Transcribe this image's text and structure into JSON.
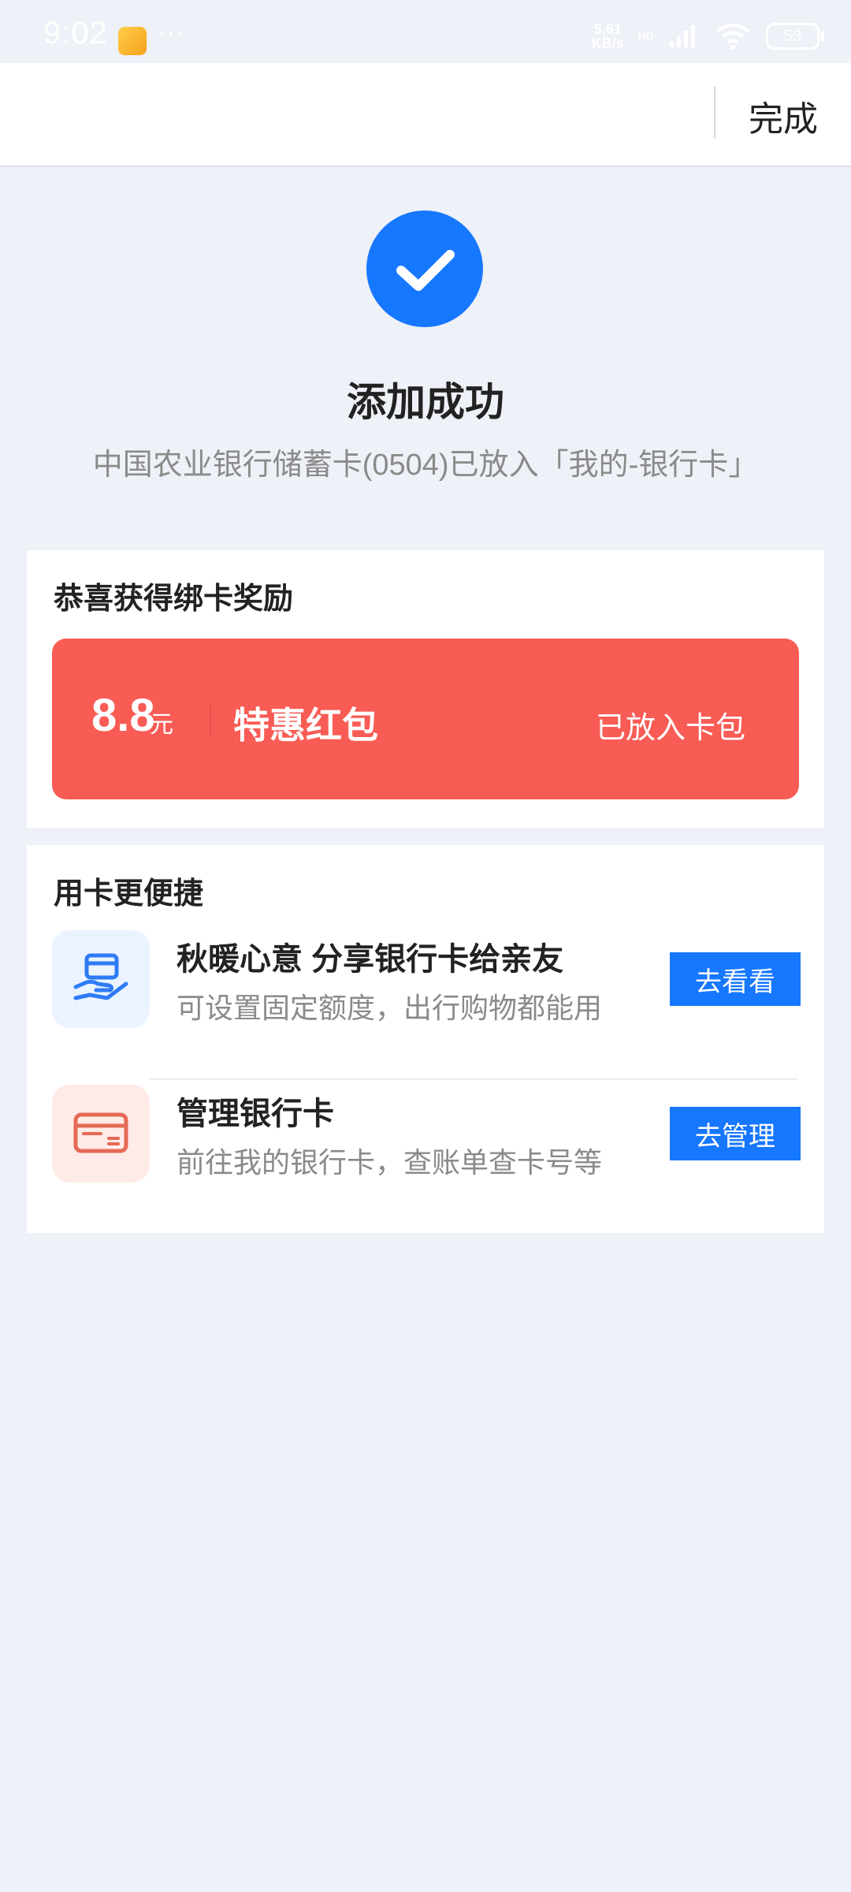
{
  "status_bar": {
    "time": "9:02",
    "dots": "···",
    "net_speed_value": "5.61",
    "net_speed_unit": "KB/s",
    "network_badge": "HD",
    "battery": "53"
  },
  "top_bar": {
    "done_label": "完成"
  },
  "success": {
    "icon": "checkmark-icon",
    "title": "添加成功",
    "subtitle": "中国农业银行储蓄卡(0504)已放入「我的-银行卡」"
  },
  "reward": {
    "section_title": "恭喜获得绑卡奖励",
    "amount": "8.8",
    "unit": "元",
    "name": "特惠红包",
    "status": "已放入卡包",
    "banner_color": "#f85c55"
  },
  "convenient": {
    "section_title": "用卡更便捷",
    "items": [
      {
        "icon": "share-card-hand-icon",
        "title": "秋暖心意 分享银行卡给亲友",
        "desc": "可设置固定额度，出行购物都能用",
        "button_label": "去看看"
      },
      {
        "icon": "bank-card-icon",
        "title": "管理银行卡",
        "desc": "前往我的银行卡，查账单查卡号等",
        "button_label": "去管理"
      }
    ]
  },
  "colors": {
    "accent": "#1677ff",
    "background": "#eef1f7"
  }
}
